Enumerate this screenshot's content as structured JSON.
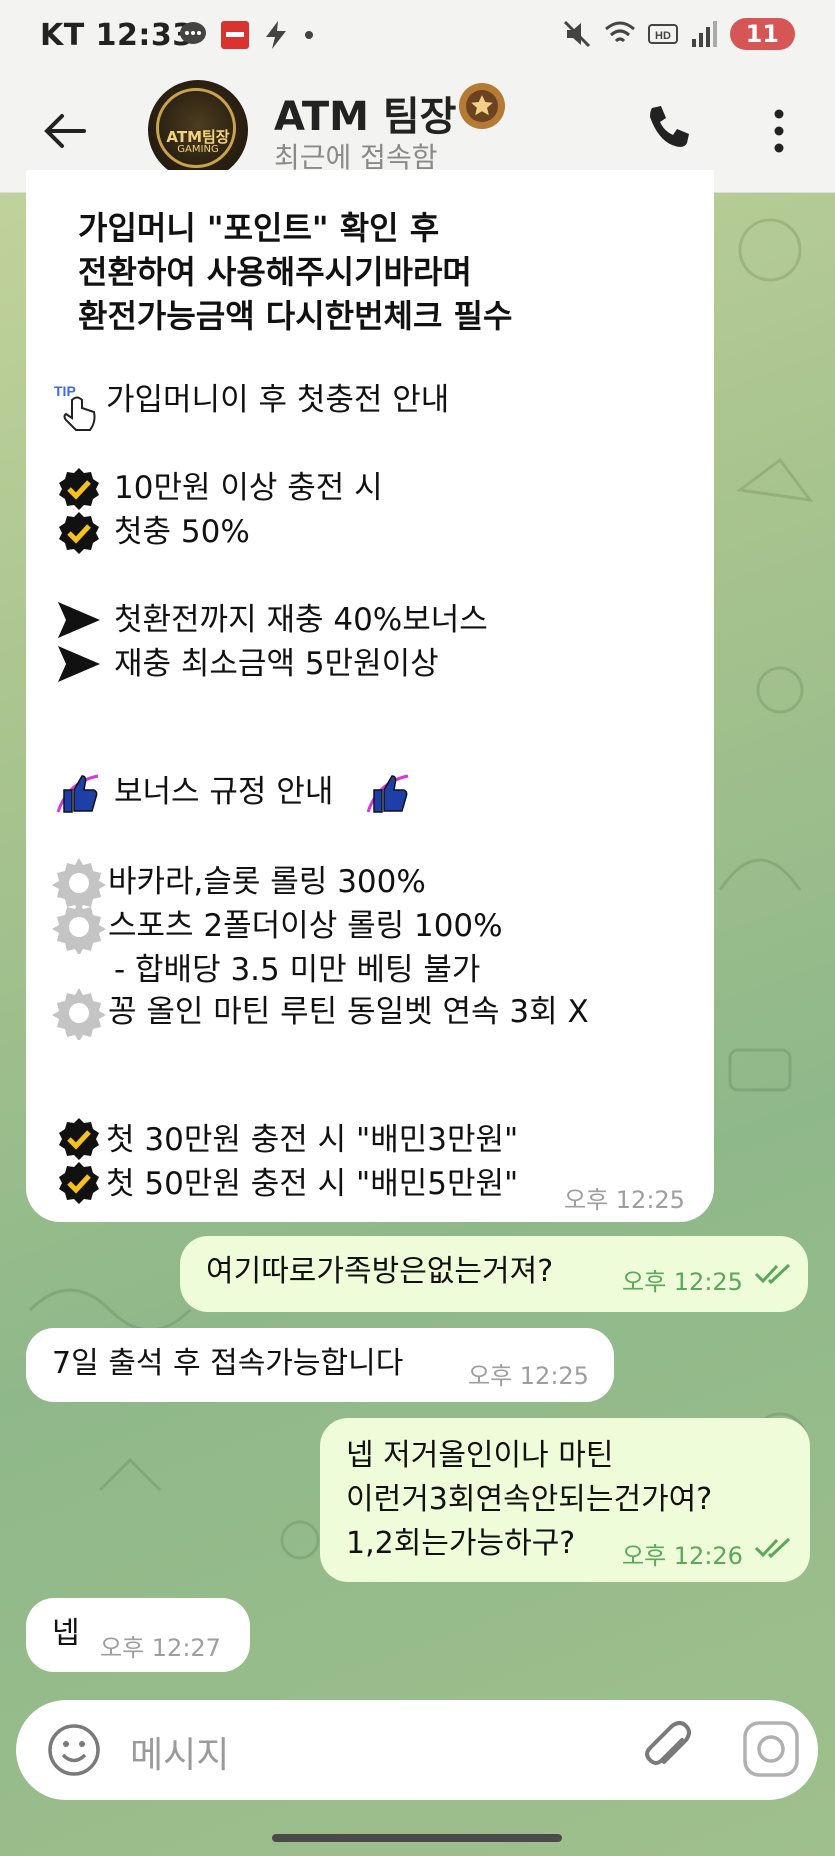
{
  "status_bar": {
    "carrier": "KT",
    "time": "12:33",
    "battery": "11"
  },
  "header": {
    "title": "ATM 팀장",
    "subtitle": "최근에 접속함",
    "avatar_line1": "ATM팀장",
    "avatar_line2": "GAMING"
  },
  "messages": {
    "m1": {
      "lines": [
        "가입머니 \"포인트\" 확인 후",
        "전환하여 사용해주시기바라며",
        "환전가능금액 다시한번체크 필수",
        "가입머니이 후 첫충전 안내",
        "10만원 이상 충전 시",
        "첫충 50%",
        "첫환전까지 재충 40%보너스",
        "재충 최소금액 5만원이상",
        "보너스 규정 안내",
        "바카라,슬롯 롤링 300%",
        "스포츠 2폴더이상 롤링 100%",
        "- 합배당 3.5 미만 베팅 불가",
        "꽁 올인 마틴 루틴 동일벳 연속 3회 X",
        "첫 30만원 충전 시 \"배민3만원\"",
        "첫 50만원 충전 시 \"배민5만원\""
      ],
      "time": "오후 12:25"
    },
    "m2": {
      "text": "여기따로가족방은없는거져?",
      "time": "오후 12:25"
    },
    "m3": {
      "text": "7일 출석 후 접속가능합니다",
      "time": "오후 12:25"
    },
    "m4": {
      "lines": [
        "넵 저거올인이나 마틴",
        "이런거3회연속안되는건가여?",
        "1,2회는가능하구?"
      ],
      "time": "오후 12:26"
    },
    "m5": {
      "text": "넵",
      "time": "오후 12:27"
    }
  },
  "composer": {
    "placeholder": "메시지"
  },
  "colors": {
    "incoming_bubble": "#ffffff",
    "outgoing_bubble": "#eefcd9",
    "read_check": "#5ca75c",
    "background": "#a9c48e"
  }
}
